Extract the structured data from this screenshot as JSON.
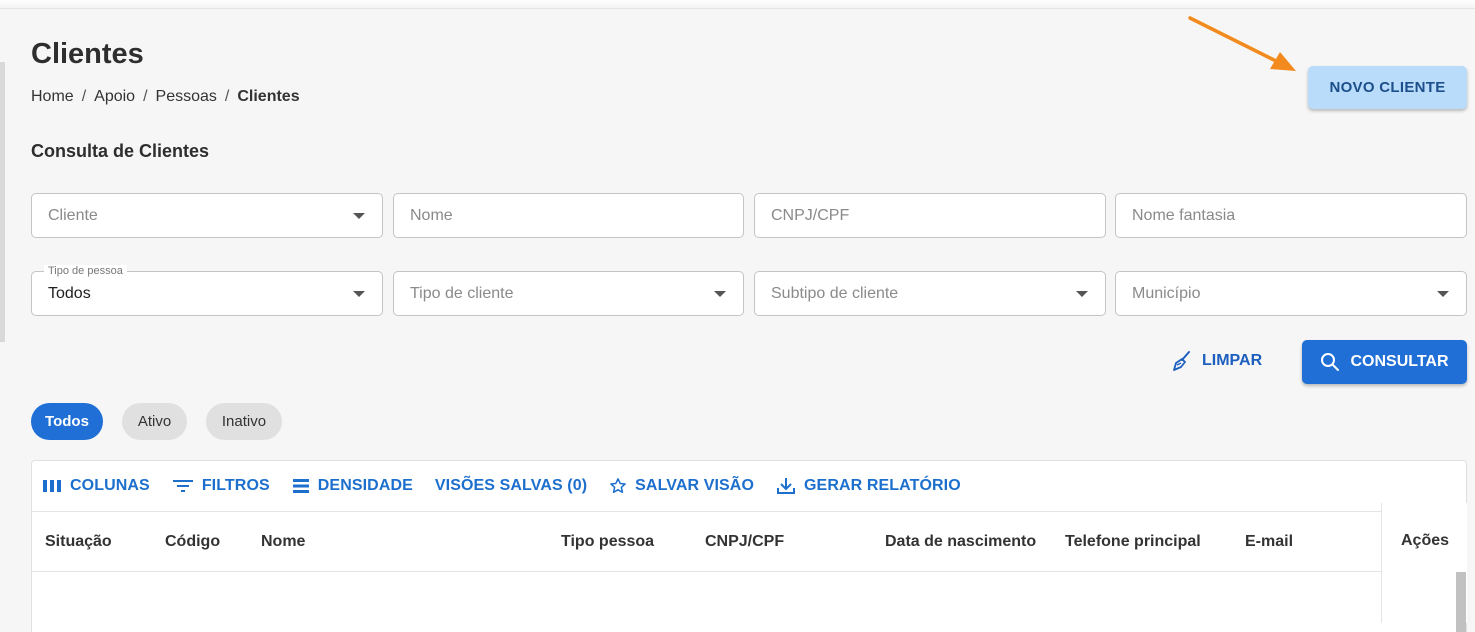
{
  "page": {
    "title": "Clientes",
    "breadcrumb": [
      "Home",
      "Apoio",
      "Pessoas",
      "Clientes"
    ],
    "breadcrumb_separator": "/"
  },
  "header": {
    "new_button_label": "NOVO CLIENTE"
  },
  "search": {
    "section_title": "Consulta de Clientes",
    "fields": {
      "cliente": {
        "placeholder": "Cliente",
        "type": "select"
      },
      "nome": {
        "placeholder": "Nome",
        "type": "text"
      },
      "cnpj_cpf": {
        "placeholder": "CNPJ/CPF",
        "type": "text"
      },
      "nome_fantasia": {
        "placeholder": "Nome fantasia",
        "type": "text"
      },
      "tipo_pessoa": {
        "label": "Tipo de pessoa",
        "value": "Todos",
        "type": "select"
      },
      "tipo_cliente": {
        "placeholder": "Tipo de cliente",
        "type": "select"
      },
      "subtipo_cliente": {
        "placeholder": "Subtipo de cliente",
        "type": "select"
      },
      "municipio": {
        "placeholder": "Município",
        "type": "select"
      }
    },
    "clear_label": "LIMPAR",
    "search_label": "CONSULTAR"
  },
  "status_filter": {
    "options": [
      "Todos",
      "Ativo",
      "Inativo"
    ],
    "selected": "Todos"
  },
  "grid": {
    "toolbar": {
      "columns": "COLUNAS",
      "filters": "FILTROS",
      "density": "DENSIDADE",
      "saved_views": "VISÕES SALVAS (0)",
      "save_view": "SALVAR VISÃO",
      "report": "GERAR RELATÓRIO"
    },
    "columns": [
      "Situação",
      "Código",
      "Nome",
      "Tipo pessoa",
      "CNPJ/CPF",
      "Data de nascimento",
      "Telefone principal",
      "E-mail",
      "Ações"
    ],
    "rows": []
  },
  "colors": {
    "primary": "#1f6fd6",
    "primary_light": "#b9dcfb",
    "link": "#1d6fce",
    "annotation_arrow": "#f28a1e"
  }
}
